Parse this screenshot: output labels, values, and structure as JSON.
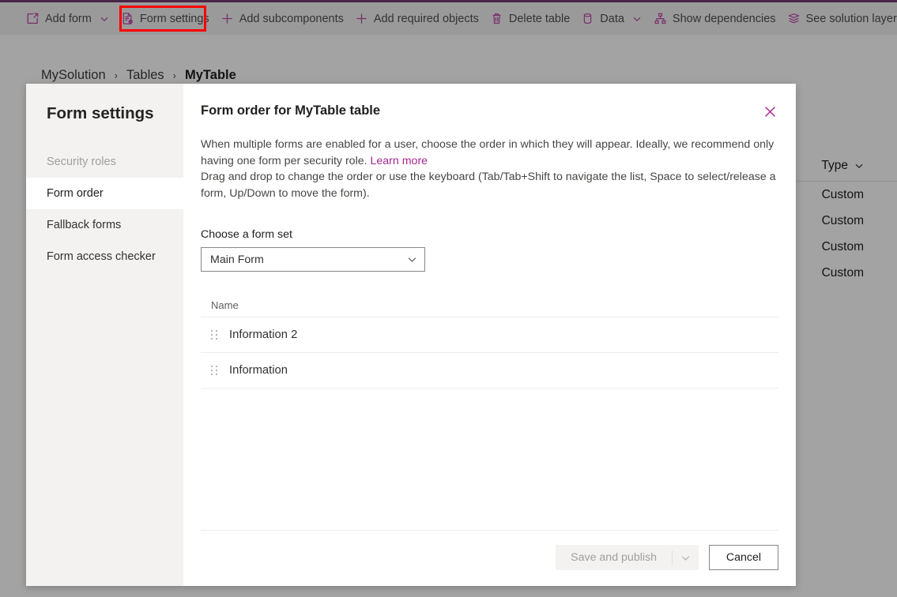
{
  "theme": {
    "top_rule_color": "#4a2545",
    "command_bar_bg": "#9a9a9a",
    "accent_purple": "#7a2e6e",
    "link_magenta": "#a4288f",
    "annotation_red": "#ff0000"
  },
  "command_bar": {
    "items": [
      {
        "label": "Add form",
        "icon": "add-form-icon",
        "has_chevron": true
      },
      {
        "label": "Form settings",
        "icon": "form-settings-icon",
        "has_chevron": false,
        "highlighted": true
      },
      {
        "label": "Add subcomponents",
        "icon": "plus-icon",
        "has_chevron": false
      },
      {
        "label": "Add required objects",
        "icon": "plus-icon",
        "has_chevron": false
      },
      {
        "label": "Delete table",
        "icon": "trash-icon",
        "has_chevron": false
      },
      {
        "label": "Data",
        "icon": "database-icon",
        "has_chevron": true
      },
      {
        "label": "Show dependencies",
        "icon": "dependencies-icon",
        "has_chevron": false
      },
      {
        "label": "See solution layers",
        "icon": "layers-icon",
        "has_chevron": false
      }
    ]
  },
  "breadcrumb": {
    "items": [
      "MySolution",
      "Tables",
      "MyTable"
    ],
    "separator": "›"
  },
  "background_grid": {
    "column_header": "Type",
    "rows": [
      "Custom",
      "Custom",
      "Custom",
      "Custom"
    ]
  },
  "modal": {
    "nav_title": "Form settings",
    "nav_items": [
      {
        "label": "Security roles",
        "state": "disabled"
      },
      {
        "label": "Form order",
        "state": "selected"
      },
      {
        "label": "Fallback forms",
        "state": "default"
      },
      {
        "label": "Form access checker",
        "state": "default"
      }
    ],
    "dialog_title": "Form order for MyTable table",
    "close_label": "Close",
    "description_line1": "When multiple forms are enabled for a user, choose the order in which they will appear. Ideally, we recommend only having one form per security role.",
    "learn_more": "Learn more",
    "description_line2": "Drag and drop to change the order or use the keyboard (Tab/Tab+Shift to navigate the list, Space to select/release a form, Up/Down to move the form).",
    "form_set_label": "Choose a form set",
    "form_set_value": "Main Form",
    "form_set_options": [
      "Main Form"
    ],
    "list_column_header": "Name",
    "forms": [
      {
        "name": "Information 2"
      },
      {
        "name": "Information"
      }
    ],
    "save_label": "Save and publish",
    "save_enabled": false,
    "cancel_label": "Cancel"
  }
}
